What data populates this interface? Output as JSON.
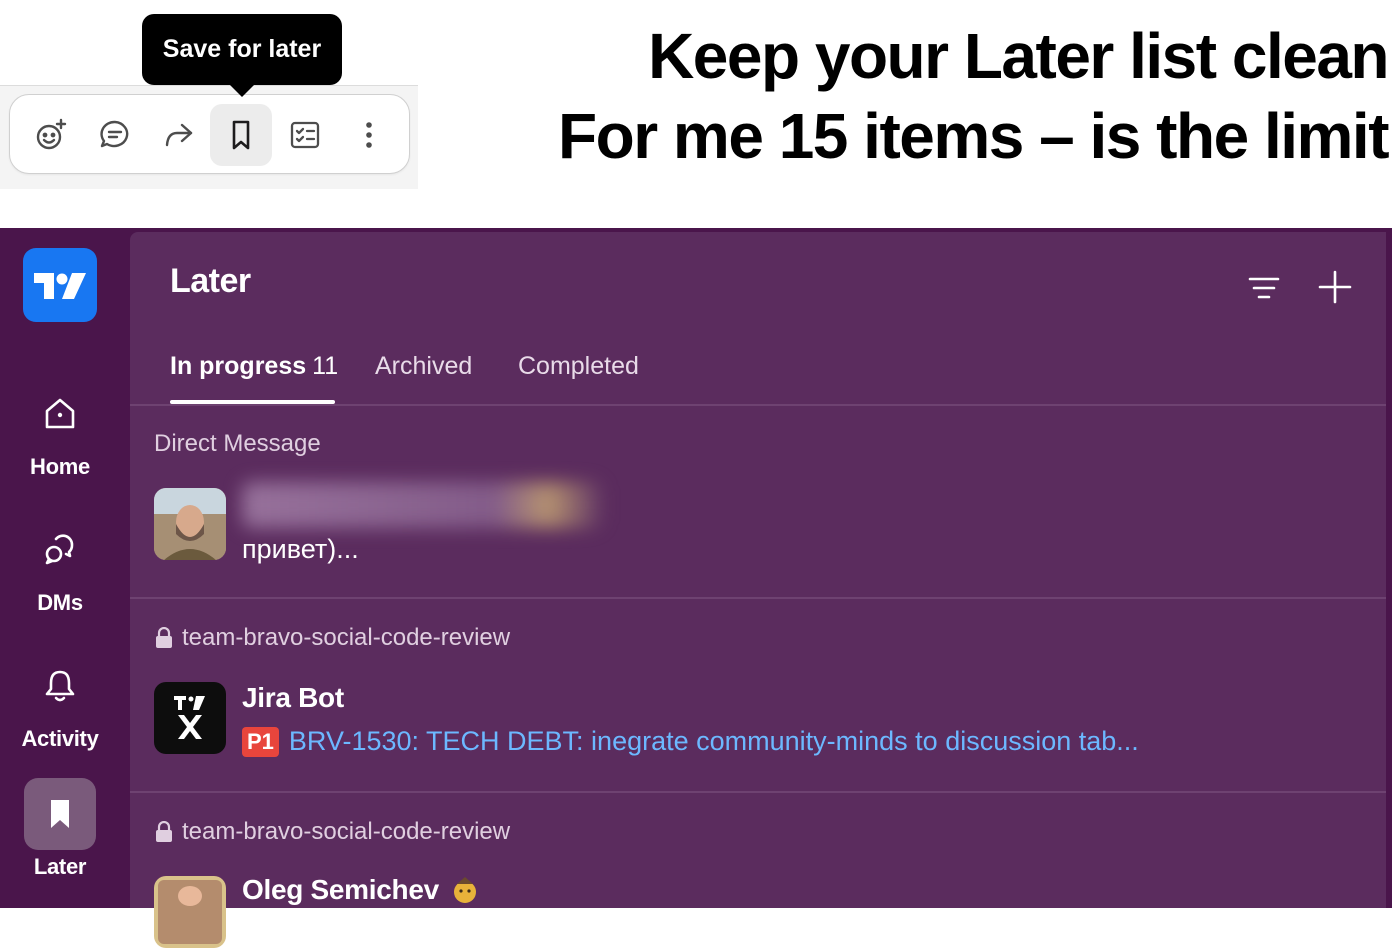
{
  "tooltip": {
    "text": "Save for later"
  },
  "toolbar": {
    "buttons": [
      {
        "icon": "add-reaction-icon"
      },
      {
        "icon": "reply-in-thread-icon"
      },
      {
        "icon": "forward-message-icon"
      },
      {
        "icon": "bookmark-icon",
        "active": true
      },
      {
        "icon": "add-to-list-icon"
      },
      {
        "icon": "more-actions-icon"
      }
    ]
  },
  "headline": {
    "line1": "Keep your Later list clean",
    "line2": "For me 15 items – is the limit"
  },
  "sidebar": {
    "items": [
      {
        "label": "Home",
        "icon": "home-icon"
      },
      {
        "label": "DMs",
        "icon": "dms-icon"
      },
      {
        "label": "Activity",
        "icon": "bell-icon"
      },
      {
        "label": "Later",
        "icon": "bookmark-icon",
        "active": true
      }
    ]
  },
  "later": {
    "title": "Later",
    "tabs": [
      {
        "label": "In progress",
        "count": "11",
        "active": true
      },
      {
        "label": "Archived"
      },
      {
        "label": "Completed"
      }
    ],
    "items": [
      {
        "section": "Direct Message",
        "message": "привет)..."
      },
      {
        "section": "team-bravo-social-code-review",
        "sender": "Jira Bot",
        "badge": "P1",
        "link": "BRV-1530: TECH DEBT: inegrate community-minds to discussion tab..."
      },
      {
        "section": "team-bravo-social-code-review",
        "sender": "Oleg Semichev"
      }
    ]
  },
  "colors": {
    "rail": "#4a154b",
    "panel": "#5b2c5e",
    "accent_blue": "#1877f2",
    "link": "#6cb8ff",
    "badge_red": "#e8453c"
  }
}
